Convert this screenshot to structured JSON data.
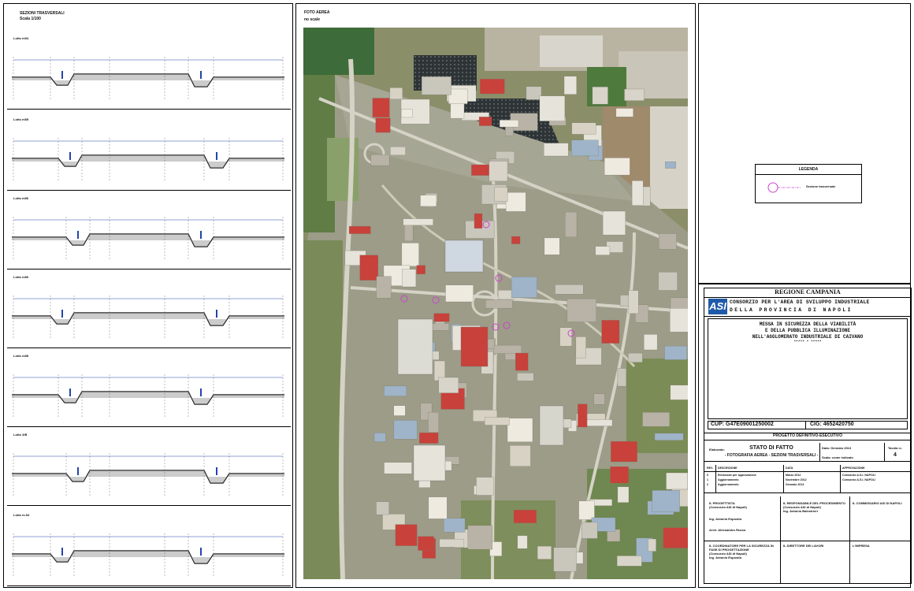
{
  "sections_panel": {
    "title": "SEZIONI TRASVERSALI",
    "scale": "Scala 1/100",
    "sections": [
      {
        "label": "Lotto m54"
      },
      {
        "label": "Lotto m55"
      },
      {
        "label": "Lotto m56"
      },
      {
        "label": "Lotto m56"
      },
      {
        "label": "Lotto m58"
      },
      {
        "label": "Lotto 3/B"
      },
      {
        "label": "Lotto m.54"
      }
    ]
  },
  "photo_panel": {
    "title": "FOTO AEREA",
    "subtitle": "no scale"
  },
  "legend": {
    "title": "LEGENDA",
    "item_label": "Sezione trasversale",
    "marker_color": "#cc44cc"
  },
  "title_block": {
    "region": "REGIONE CAMPANIA",
    "logo_text": "ASI",
    "consortium_line1": "CONSORZIO PER L'AREA DI SVILUPPO INDUSTRIALE",
    "consortium_line2": "DELLA PROVINCIA DI NAPOLI",
    "project_line1": "MESSA IN SICUREZZA DELLA VIABILITÀ",
    "project_line2": "E DELLA PUBBLICA ILLUMINAZIONE",
    "project_line3": "NELL'AGGLOMERATO INDUSTRIALE DI CAIVANO",
    "project_line4": "***** * *****",
    "cup": "CUP: G47E09001250002",
    "cig": "CIG: 4652420750",
    "phase": "PROGETTO DEFINITIVO-ESECUTIVO",
    "drawing_type_label": "Elaborato:",
    "drawing_title": "STATO DI FATTO",
    "drawing_subtitle": "- FOTOGRAFIA AEREA - SEZIONI TRASVERSALI -",
    "date_label": "Data: Gennaio 2013",
    "sheet_label": "Tavola n.:",
    "sheet_number": "4",
    "scale_label": "Scala: come indicato",
    "rev_headers": [
      "REV.",
      "DESCRIZIONE",
      "DATA",
      "APPROVAZIONE"
    ],
    "revisions": [
      {
        "rev": "0",
        "desc": "Emissione per approvazione",
        "date": "Marzo 2012",
        "appr": "Consorzio A.S.I. NAPOLI"
      },
      {
        "rev": "1",
        "desc": "Aggiornamento",
        "date": "Novembre 2012",
        "appr": "Consorzio A.S.I. NAPOLI"
      },
      {
        "rev": "2",
        "desc": "Aggiornamento",
        "date": "Gennaio 2013",
        "appr": ""
      }
    ],
    "role_designer": "IL PROGETTISTA",
    "role_designer_sub": "(Consorzio ASI di Napoli)",
    "role_designer_name": "Ing. Antonio Esposito",
    "role_geologist": "Arch. Alessandro Russo",
    "role_rup": "IL RESPONSABILE DEL PROCEDIMENTO",
    "role_rup_sub": "(Consorzio ASI di Napoli)",
    "role_rup_name": "Ing. Antonio Balestrieri",
    "role_commissioner": "IL COMMISSARIO ASI DI NAPOLI",
    "role_safety": "IL COORDINATORE PER LA SICUREZZA IN FASE DI PROGETTAZIONE",
    "role_safety_sub": "(Consorzio ASI di Napoli)",
    "role_safety_name": "Ing. Antonio Esposito",
    "role_works": "IL DIRETTORE DEI LAVORI",
    "role_company": "L'IMPRESA"
  }
}
